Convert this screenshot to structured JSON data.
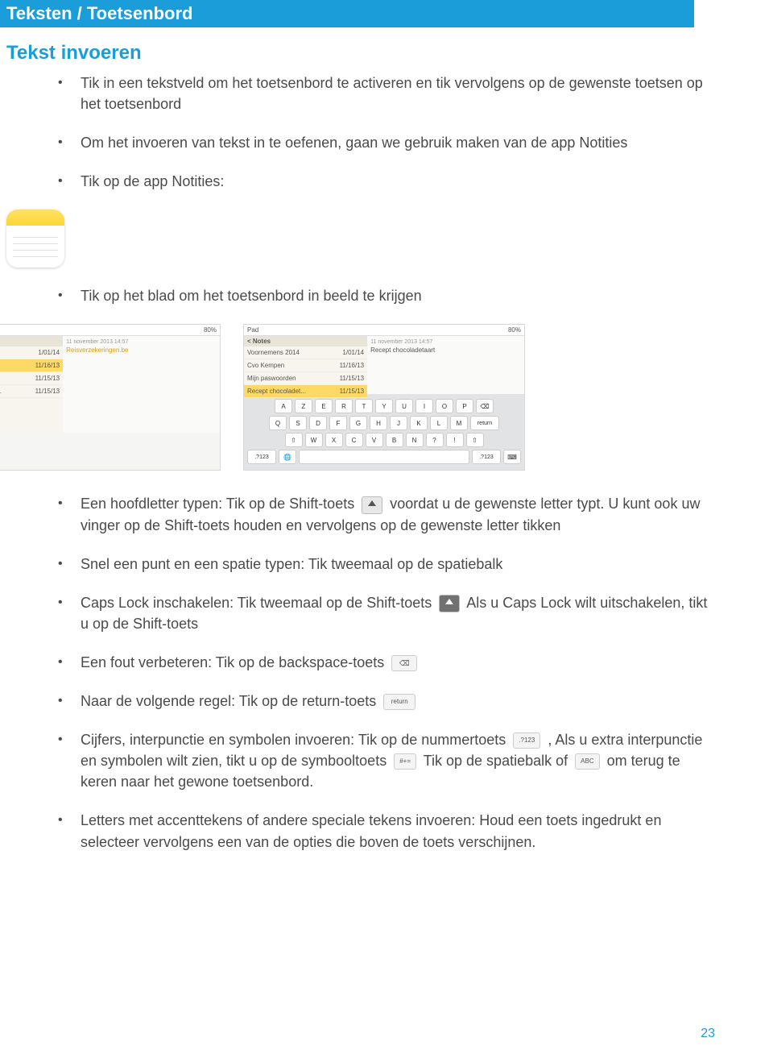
{
  "header": "Teksten / Toetsenbord",
  "subtitle": "Tekst invoeren",
  "bullets": {
    "b1": "Tik in een tekstveld om het toetsenbord te activeren en tik vervolgens op de gewenste toetsen op het toetsenbord",
    "b2": "Om het invoeren van tekst in te oefenen, gaan we gebruik maken van de app Notities",
    "b3": "Tik op de app Notities:",
    "b4": "Tik op het blad om het toetsenbord in beeld te krijgen",
    "b5a": "Een hoofdletter typen: Tik op de Shift-toets ",
    "b5b": " voordat u de gewenste letter typt. U kunt ook uw vinger op de Shift-toets houden en vervolgens op de gewenste letter tikken",
    "b6": "Snel een punt en een spatie typen: Tik tweemaal op de spatiebalk",
    "b7a": "Caps Lock inschakelen: Tik tweemaal op de Shift-toets ",
    "b7b": " Als u Caps Lock wilt uitschakelen, tikt u op de Shift-toets",
    "b8": "Een fout verbeteren: Tik op de backspace-toets ",
    "b9": "Naar de volgende regel: Tik op de return-toets ",
    "b10a": "Cijfers, interpunctie en symbolen invoeren: Tik op de nummertoets ",
    "b10b": ", Als u extra interpunctie en symbolen wilt zien, tikt u op de symbooltoets ",
    "b10c": " Tik op de spatiebalk of ",
    "b10d": " om terug te keren naar het gewone toetsenbord.",
    "b11": "Letters met accenttekens of andere speciale tekens invoeren: Houd een toets ingedrukt en selecteer vervolgens een van de opties die boven de toets verschijnen."
  },
  "screenshot": {
    "time": "Pad",
    "batt": "80%",
    "header_left": "< Notes",
    "date_line": "11 november 2013 14:57",
    "recipe_title": "Recept chocoladetaart",
    "reis_title": "Reisverzekeringen.be",
    "rows": [
      {
        "label": "Voornemens 2014",
        "date": "1/01/14"
      },
      {
        "label": "Cvo Kempen",
        "date": "11/16/13"
      },
      {
        "label": "Mijn paswoorden",
        "date": "11/15/13"
      },
      {
        "label": "Recept chocoladet...",
        "date": "11/15/13"
      }
    ],
    "kb_rows": [
      [
        "A",
        "Z",
        "E",
        "R",
        "T",
        "Y",
        "U",
        "I",
        "O",
        "P"
      ],
      [
        "Q",
        "S",
        "D",
        "F",
        "G",
        "H",
        "J",
        "K",
        "L",
        "M"
      ],
      [
        "W",
        "X",
        "C",
        "V",
        "B",
        "N",
        "?",
        "!"
      ]
    ],
    "kb_special": {
      "return": "return",
      "n123a": ".?123",
      "n123b": ".?123"
    }
  },
  "keys": {
    "backspace": "⌫",
    "return": "return",
    "num": ".?123",
    "abc": "ABC",
    "sym": "#+="
  },
  "page_number": "23"
}
